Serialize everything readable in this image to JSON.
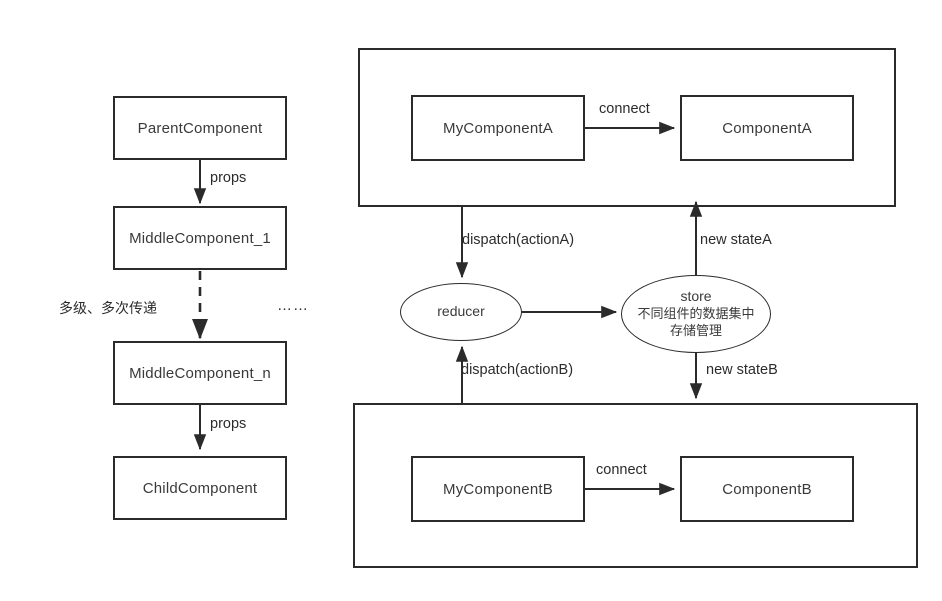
{
  "diagram": {
    "title": "React props drilling vs Redux store data flow",
    "stroke_color": "#2b2b2b",
    "text_color": "#3a3a3a",
    "background": "#ffffff"
  },
  "left_flow": {
    "nodes": [
      {
        "id": "parent",
        "label": "ParentComponent"
      },
      {
        "id": "middle1",
        "label": "MiddleComponent_1"
      },
      {
        "id": "middlen",
        "label": "MiddleComponent_n"
      },
      {
        "id": "child",
        "label": "ChildComponent"
      }
    ],
    "edges": [
      {
        "id": "parent-to-middle1",
        "label": "props",
        "style": "solid"
      },
      {
        "id": "middle1-to-middlen",
        "label": "",
        "style": "dashed"
      },
      {
        "id": "middlen-to-child",
        "label": "props",
        "style": "solid"
      }
    ],
    "annotation": "多级、多次传递",
    "ellipsis": "……"
  },
  "right_flow": {
    "group_a": {
      "label": "",
      "nodes": [
        {
          "id": "mycomponenta",
          "label": "MyComponentA"
        },
        {
          "id": "componenta",
          "label": "ComponentA"
        }
      ],
      "edge_label": "connect"
    },
    "group_b": {
      "label": "",
      "nodes": [
        {
          "id": "mycomponentb",
          "label": "MyComponentB"
        },
        {
          "id": "componentb",
          "label": "ComponentB"
        }
      ],
      "edge_label": "connect"
    },
    "reducer": {
      "label": "reducer"
    },
    "store": {
      "label": "store",
      "description_line1": "不同组件的数据集中",
      "description_line2": "存储管理"
    },
    "edges": [
      {
        "id": "a-dispatch",
        "label": "dispatch(actionA)"
      },
      {
        "id": "a-newstate",
        "label": "new stateA"
      },
      {
        "id": "b-dispatch",
        "label": "dispatch(actionB)"
      },
      {
        "id": "b-newstate",
        "label": "new stateB"
      },
      {
        "id": "reducer-to-store",
        "label": ""
      }
    ]
  }
}
